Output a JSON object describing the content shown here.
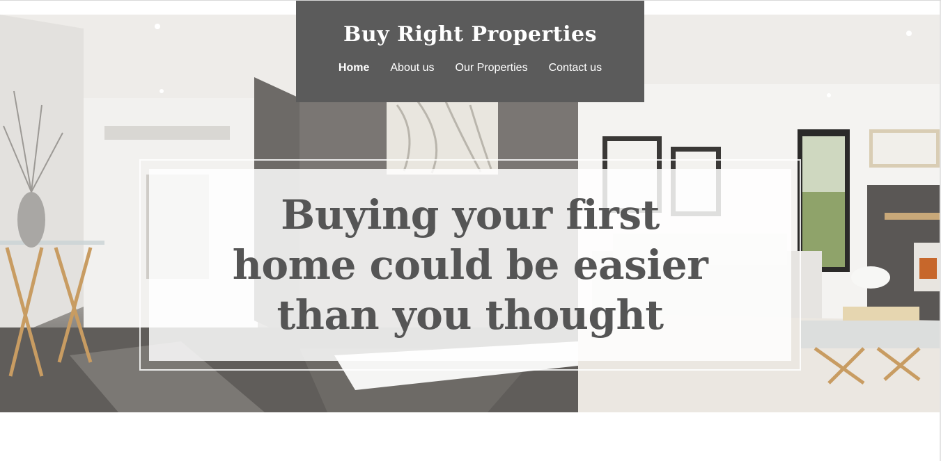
{
  "header": {
    "title": "Buy Right Properties",
    "nav": [
      {
        "label": "Home",
        "active": true
      },
      {
        "label": "About us",
        "active": false
      },
      {
        "label": "Our Properties",
        "active": false
      },
      {
        "label": "Contact us",
        "active": false
      }
    ]
  },
  "hero": {
    "headline": "Buying your first home could be easier than you thought"
  },
  "colors": {
    "header_bg": "#5b5b5b",
    "headline_text": "#555555",
    "card_bg": "#ffffff"
  }
}
